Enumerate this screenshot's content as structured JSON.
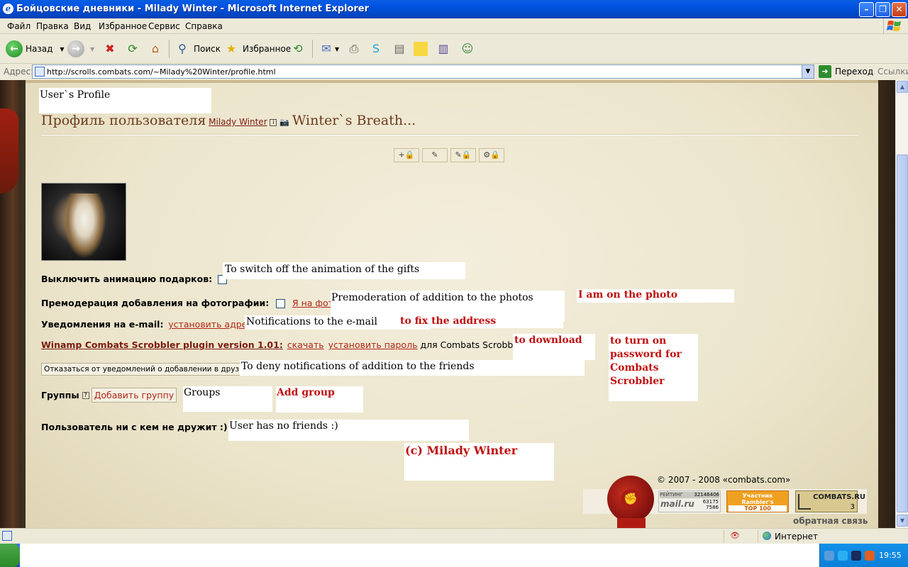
{
  "window": {
    "title": "Бойцовские дневники - Milady Winter - Microsoft Internet Explorer"
  },
  "menu": [
    "Файл",
    "Правка",
    "Вид",
    "Избранное",
    "Сервис",
    "Справка"
  ],
  "toolbar": {
    "back": "Назад",
    "search": "Поиск",
    "favorites": "Избранное"
  },
  "address": {
    "label": "Адрес:",
    "url": "http://scrolls.combats.com/~Milady%20Winter/profile.html",
    "go": "Переход",
    "links": "Ссылки"
  },
  "page": {
    "users_profile_note": "User`s Profile",
    "profile_heading": "Профиль пользователя",
    "username": "Milady Winter",
    "info_icon_text": "i",
    "diary_title": "Winter`s Breath...",
    "gifts_label": "Выключить анимацию подарков:",
    "gifts_note": "To switch off the animation of the gifts",
    "premod_label": "Премодерация добавления на фотографии:",
    "premod_link": "Я на фото",
    "premod_note": "Premoderation of addition to the photos",
    "on_photo_note": "I am on the photo",
    "email_label": "Уведомления на e-mail:",
    "email_link": "установить адрес",
    "email_note": "Notifications to the e-mail",
    "fix_address_note": "to fix the address",
    "winamp_link": "Winamp Combats Scrobbler plugin version 1.01:",
    "download_link": "скачать",
    "set_password_link": "установить пароль",
    "winamp_tail": "для Combats Scrobbler.",
    "download_note": "to download",
    "turn_on_note_1": "to turn on",
    "turn_on_note_2": "password for",
    "turn_on_note_3": "Combats",
    "turn_on_note_4": "Scrobbler",
    "deny_button": "Отказаться от уведомлений о добавлении в друзья",
    "deny_note": "To deny notifications of addition to the friends",
    "groups_label": "Группы",
    "groups_help": "?",
    "add_group_button": "Добавить группу",
    "groups_note": "Groups",
    "add_group_note": "Add group",
    "no_friends": "Пользователь ни с кем не дружит :)",
    "no_friends_note": "User has no friends :)",
    "copyright_note": "(c) Milady Winter",
    "footer_copyright": "© 2007 - 2008 «combats.com»",
    "feedback": "обратная связь",
    "mailru_rating_label": "РЕЙТИНГ",
    "mailru_rating_value": "32146406",
    "mailru_logo": "mail.ru",
    "mailru_num_1": "63175",
    "mailru_num_2": "7586",
    "rambler_1": "Участник",
    "rambler_2": "Rambler's",
    "rambler_3": "TOP 100",
    "combats_badge": "COMBATS.RU",
    "combats_badge_num": "3",
    "stamp_glyph": "✊"
  },
  "action_icons": [
    "+🔒",
    "✎",
    "✎🔒",
    "⚙🔒"
  ],
  "status": {
    "zone": "Интернет"
  },
  "taskbar": {
    "clock": "19:55"
  },
  "colors": {
    "accent_red": "#c01010",
    "link_brown": "#7a1a10",
    "parchment": "#ece5cc",
    "xp_blue": "#0054e3"
  }
}
